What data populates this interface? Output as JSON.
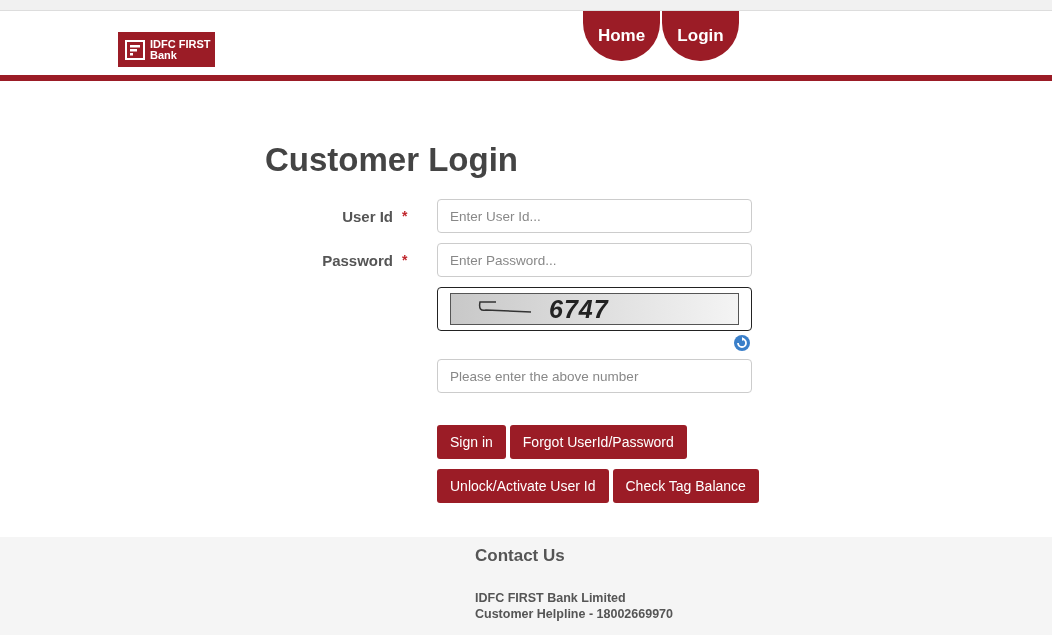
{
  "logo": {
    "line_1": "IDFC FIRST",
    "line_2": "Bank"
  },
  "nav": [
    {
      "label": "Home"
    },
    {
      "label": "Login"
    }
  ],
  "title": "Customer Login",
  "fields": [
    {
      "label": "User Id",
      "required_mark": "*",
      "placeholder": "Enter User Id..."
    },
    {
      "label": "Password",
      "required_mark": "*",
      "placeholder": "Enter Password..."
    }
  ],
  "captcha": {
    "code": "6747"
  },
  "captcha_field": {
    "placeholder": "Please enter the above number"
  },
  "button_rows": [
    [
      "Sign in",
      "Forgot UserId/Password"
    ],
    [
      "Unlock/Activate User Id",
      "Check Tag Balance"
    ]
  ],
  "footer": {
    "heading": "Contact Us",
    "lines": [
      "IDFC FIRST Bank Limited",
      "Customer Helpline - 18002669970"
    ]
  }
}
